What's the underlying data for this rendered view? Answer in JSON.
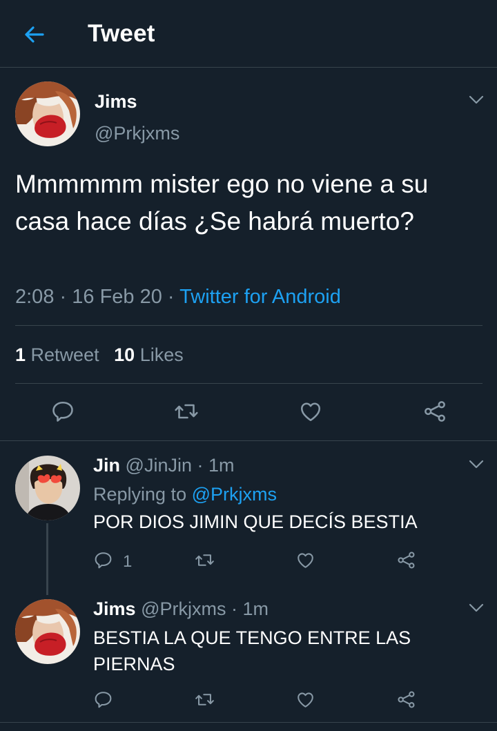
{
  "header": {
    "title": "Tweet",
    "back_icon": "arrow-left-icon"
  },
  "main_tweet": {
    "display_name": "Jims",
    "handle": "@Prkjxms",
    "text": "Mmmmmm mister ego no viene a su casa hace días ¿Se habrá muerto?",
    "time": "2:08",
    "date": "16 Feb 20",
    "source": "Twitter for Android",
    "retweets_count": "1",
    "retweets_label": "Retweet",
    "likes_count": "10",
    "likes_label": "Likes"
  },
  "replies": [
    {
      "display_name": "Jin",
      "handle": "@JinJin",
      "dot": "·",
      "age": "1m",
      "replying_label": "Replying to",
      "replying_to": "@Prkjxms",
      "text": "POR DIOS JIMIN QUE DECÍS BESTIA",
      "reply_count": "1"
    },
    {
      "display_name": "Jims",
      "handle": "@Prkjxms",
      "dot": "·",
      "age": "1m",
      "text": "BESTIA LA QUE TENGO ENTRE LAS PIERNAS"
    }
  ],
  "separator": "·",
  "colors": {
    "background": "#15202b",
    "divider": "#38444d",
    "muted": "#8899a6",
    "accent": "#1da1f2",
    "text": "#ffffff"
  },
  "icons": [
    "reply-icon",
    "retweet-icon",
    "like-icon",
    "share-icon",
    "chevron-down-icon"
  ]
}
